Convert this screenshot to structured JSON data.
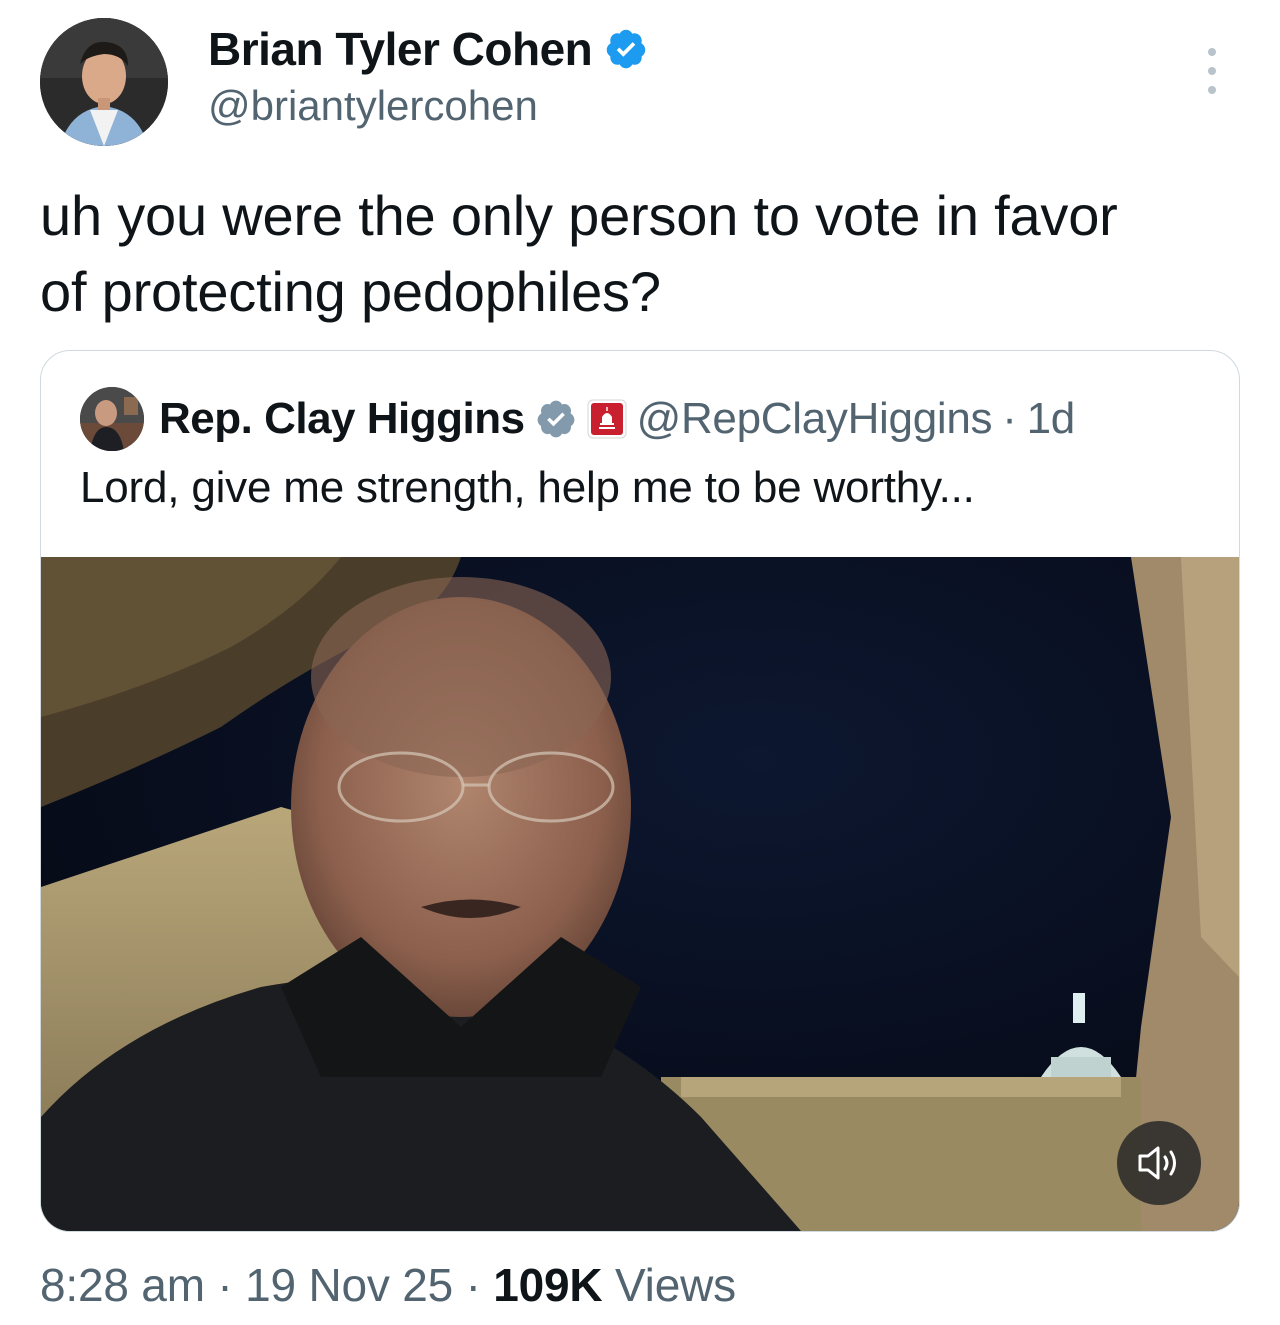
{
  "author": {
    "display_name": "Brian Tyler Cohen",
    "handle": "@briantylercohen",
    "verified_icon": "verified-badge-icon",
    "badge_color": "#1d9bf0"
  },
  "tweet": {
    "text_line1": "uh you were the only person to vote in favor",
    "text_line2": "of protecting pedophiles?"
  },
  "quoted": {
    "display_name": "Rep. Clay Higgins",
    "handle": "@RepClayHiggins",
    "separator": "·",
    "age": "1d",
    "text": "Lord, give me strength, help me to be worthy...",
    "verified_icon": "gray-verified-badge-icon",
    "affiliation_icon": "capitol-affiliation-icon"
  },
  "meta": {
    "time": "8:28 am",
    "sep1": " · ",
    "date": "19 Nov 25",
    "sep2": " · ",
    "views_count": "109K",
    "views_label": " Views"
  },
  "colors": {
    "text": "#0f1419",
    "secondary": "#536471",
    "border": "#cfd9de"
  }
}
